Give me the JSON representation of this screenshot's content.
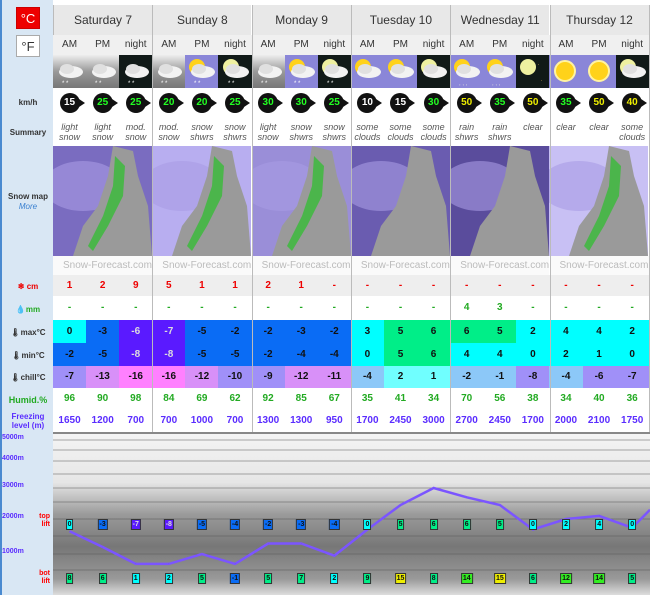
{
  "units": {
    "celsius": "°C",
    "fahrenheit": "°F",
    "active": "celsius"
  },
  "labels": {
    "wind": "km/h",
    "summary": "Summary",
    "snow_map": "Snow map",
    "more": "More",
    "snow": "cm",
    "rain": "mm",
    "max": "max°C",
    "min": "min°C",
    "chill": "chill°C",
    "humid": "Humid.%",
    "freezing": "Freezing level (m)",
    "top_lift": "top lift",
    "bot_lift": "bot lift"
  },
  "days": [
    {
      "name": "Saturday 7"
    },
    {
      "name": "Sunday 8"
    },
    {
      "name": "Monday 9"
    },
    {
      "name": "Tuesday 10"
    },
    {
      "name": "Wednesday 11"
    },
    {
      "name": "Thursday 12"
    }
  ],
  "periods": [
    "AM",
    "PM",
    "night"
  ],
  "watermark": "Snow-Forecast.com",
  "icons": [
    "cloud-snow",
    "cloud-snow",
    "night-cloud-snow",
    "cloud-snow",
    "sun-cloud-snow",
    "moon-cloud-snow",
    "cloud-snow",
    "sun-cloud-snow",
    "moon-cloud-snow",
    "sun-cloud",
    "sun-cloud",
    "moon-cloud",
    "sun-cloud-rain",
    "sun-cloud-rain",
    "moon-clear",
    "sun",
    "sun",
    "moon-cloud"
  ],
  "wind": [
    15,
    25,
    25,
    20,
    20,
    25,
    30,
    30,
    25,
    10,
    15,
    30,
    50,
    35,
    50,
    35,
    50,
    40
  ],
  "summary": [
    "light snow",
    "light snow",
    "mod. snow",
    "mod. snow",
    "snow shwrs",
    "snow shwrs",
    "light snow",
    "snow shwrs",
    "snow shwrs",
    "some clouds",
    "some clouds",
    "some clouds",
    "rain shwrs",
    "rain shwrs",
    "clear",
    "clear",
    "clear",
    "some clouds"
  ],
  "snow_cm": [
    "1",
    "2",
    "9",
    "5",
    "1",
    "1",
    "2",
    "1",
    "-",
    "-",
    "-",
    "-",
    "-",
    "-",
    "-",
    "-",
    "-",
    "-"
  ],
  "rain_mm": [
    "-",
    "-",
    "-",
    "-",
    "-",
    "-",
    "-",
    "-",
    "-",
    "-",
    "-",
    "-",
    "4",
    "3",
    "-",
    "-",
    "-",
    "-"
  ],
  "max_c": [
    0,
    -3,
    -6,
    -7,
    -5,
    -2,
    -2,
    -3,
    -2,
    3,
    5,
    6,
    6,
    5,
    2,
    4,
    4,
    2
  ],
  "min_c": [
    -2,
    -5,
    -8,
    -8,
    -5,
    -5,
    -2,
    -4,
    -4,
    0,
    5,
    6,
    4,
    4,
    0,
    2,
    1,
    0
  ],
  "chill_c": [
    -7,
    -13,
    -16,
    -16,
    -12,
    -10,
    -9,
    -12,
    -11,
    -4,
    2,
    1,
    -2,
    -1,
    -8,
    -4,
    -6,
    -7
  ],
  "humid": [
    96,
    90,
    98,
    84,
    69,
    62,
    92,
    85,
    67,
    35,
    41,
    34,
    70,
    56,
    38,
    34,
    40,
    36
  ],
  "freezing": [
    1650,
    1200,
    700,
    700,
    1000,
    700,
    1300,
    1300,
    950,
    1700,
    2450,
    3000,
    2700,
    2450,
    1700,
    2000,
    2100,
    1750
  ],
  "chart": {
    "y_ticks": [
      "5000m",
      "4000m",
      "3000m",
      "2000m",
      "1000m"
    ],
    "top_lift": [
      0,
      -3,
      -7,
      -8,
      -5,
      -4,
      -2,
      -3,
      -4,
      0,
      5,
      6,
      6,
      5,
      0,
      2,
      4,
      0
    ],
    "bot_lift": [
      8,
      6,
      1,
      2,
      5,
      -1,
      5,
      7,
      2,
      9,
      15,
      8,
      14,
      15,
      6,
      12,
      14,
      5
    ],
    "line_color": "#7b55ff"
  }
}
